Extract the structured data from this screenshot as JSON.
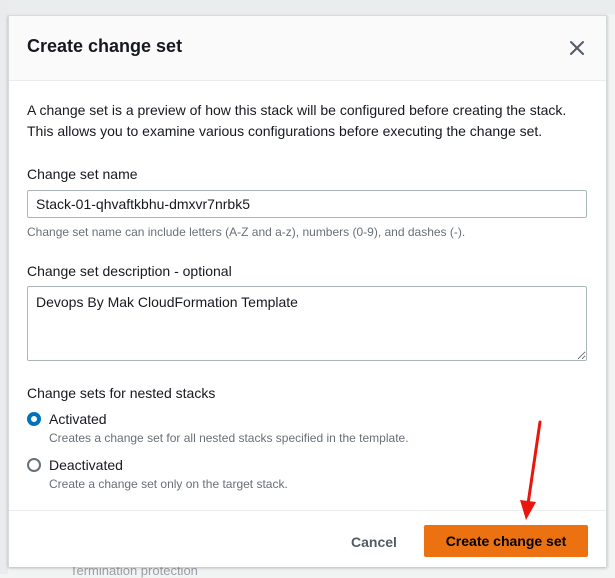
{
  "background": {
    "partial_text": "Termination protection"
  },
  "modal": {
    "title": "Create change set",
    "intro": "A change set is a preview of how this stack will be configured before creating the stack. This allows you to examine various configurations before executing the change set.",
    "name_field": {
      "label": "Change set name",
      "value": "Stack-01-qhvaftkbhu-dmxvr7nrbk5",
      "hint": "Change set name can include letters (A-Z and a-z), numbers (0-9), and dashes (-)."
    },
    "description_field": {
      "label": "Change set description - optional",
      "value": "Devops By Mak CloudFormation Template"
    },
    "nested_stacks": {
      "label": "Change sets for nested stacks",
      "selected": "Activated",
      "options": [
        {
          "label": "Activated",
          "description": "Creates a change set for all nested stacks specified in the template."
        },
        {
          "label": "Deactivated",
          "description": "Create a change set only on the target stack."
        }
      ]
    },
    "footer": {
      "cancel_label": "Cancel",
      "primary_label": "Create change set"
    }
  },
  "colors": {
    "primary_button": "#ec7211",
    "radio_selected": "#0073bb",
    "annotation_arrow": "#e8160c"
  }
}
